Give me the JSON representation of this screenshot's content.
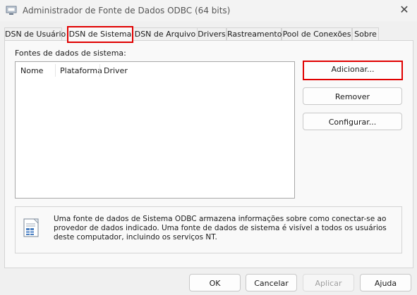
{
  "window": {
    "title": "Administrador de Fonte de Dados ODBC (64 bits)",
    "close_glyph": "✕"
  },
  "tabs": [
    {
      "label": "DSN de Usuário",
      "active": false
    },
    {
      "label": "DSN de Sistema",
      "active": true
    },
    {
      "label": "DSN de Arquivo",
      "active": false
    },
    {
      "label": "Drivers",
      "active": false
    },
    {
      "label": "Rastreamento",
      "active": false
    },
    {
      "label": "Pool de Conexões",
      "active": false
    },
    {
      "label": "Sobre",
      "active": false
    }
  ],
  "main": {
    "list_label": "Fontes de dados de sistema:",
    "columns": [
      "Nome",
      "Plataforma",
      "Driver"
    ],
    "rows": []
  },
  "side_buttons": {
    "add": "Adicionar...",
    "remove": "Remover",
    "configure": "Configurar..."
  },
  "info": {
    "text": "Uma fonte de dados de Sistema ODBC armazena informações sobre como conectar-se ao provedor de dados indicado. Uma fonte de dados de sistema é visível a todos os usuários deste computador, incluindo os serviços NT."
  },
  "footer": {
    "ok": "OK",
    "cancel": "Cancelar",
    "apply": "Aplicar",
    "help": "Ajuda"
  },
  "colors": {
    "highlight": "#e00000",
    "background": "#f0f0f0"
  },
  "icons": {
    "title": "odbc-app-icon",
    "close": "close-icon",
    "info": "datasource-info-icon"
  }
}
